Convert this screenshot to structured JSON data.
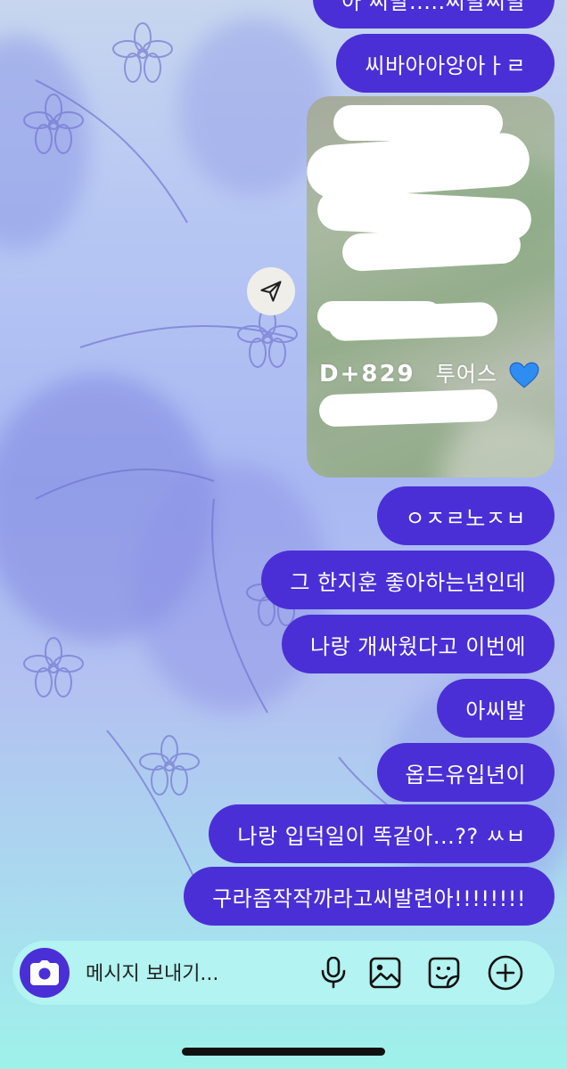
{
  "messages": [
    {
      "text": "아 씨발.....씨발씨발"
    },
    {
      "text": "씨바아아앙아ㅏㄹ"
    },
    {
      "text": "ㅇㅈㄹ노ㅈㅂ"
    },
    {
      "text": "그 한지훈 좋아하는년인데"
    },
    {
      "text": "나랑 개싸웠다고 이번에"
    },
    {
      "text": "아씨발"
    },
    {
      "text": "옵드유입년이"
    },
    {
      "text": "나랑 입덕일이 똑같아...?? ㅆㅂ"
    },
    {
      "text": "구라좀작작까라고씨발련아!!!!!!!!"
    }
  ],
  "shared_photo": {
    "caption_code": "D+829",
    "caption_text": "투어스",
    "emoji": "blue-heart"
  },
  "composer": {
    "placeholder": "메시지 보내기..."
  },
  "colors": {
    "bubble": "#4a2fd6",
    "composer_bg": "#b3f3f1",
    "camera_button": "#4a2fd6"
  },
  "icons": [
    "send-arrow-icon",
    "camera-icon",
    "microphone-icon",
    "gallery-icon",
    "sticker-icon",
    "plus-icon"
  ]
}
